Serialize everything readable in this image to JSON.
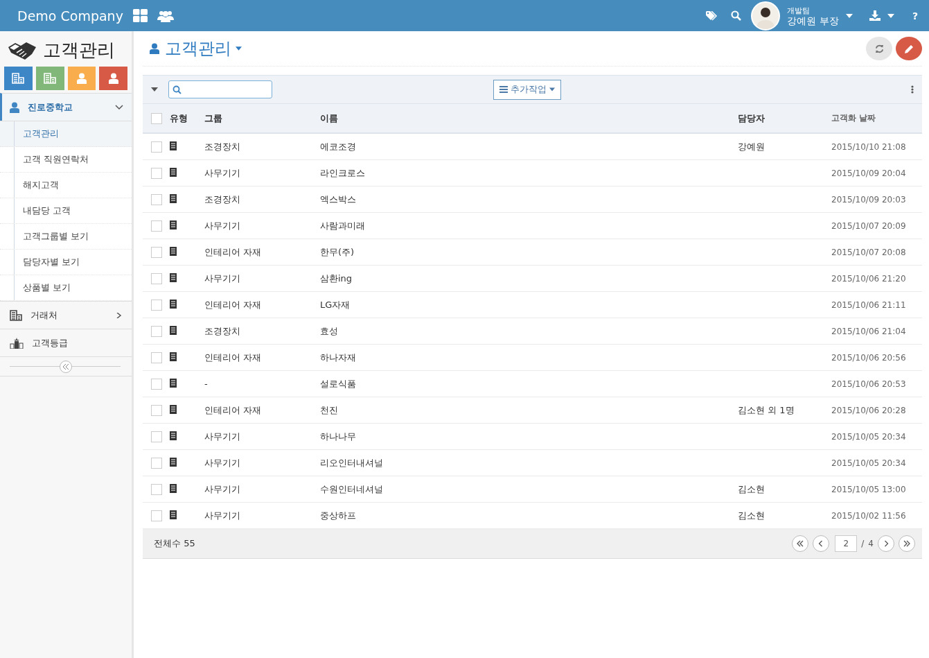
{
  "header": {
    "brand": "Demo Company",
    "user": {
      "team": "개발팀",
      "name": "강예원 부장"
    },
    "help": "?"
  },
  "sidebar": {
    "title": "고객관리",
    "tiles": [
      {
        "kind": "building",
        "color": "#3d87c6"
      },
      {
        "kind": "building",
        "color": "#82b77a"
      },
      {
        "kind": "person",
        "color": "#f9ad4c"
      },
      {
        "kind": "person",
        "color": "#d65a46"
      }
    ],
    "menu": [
      {
        "label": "진로중학교",
        "kind": "person",
        "expanded": true,
        "children": [
          {
            "label": "고객관리",
            "selected": true
          },
          {
            "label": "고객 직원연락처",
            "selected": false
          },
          {
            "label": "해지고객",
            "selected": false
          },
          {
            "label": "내담당 고객",
            "selected": false
          },
          {
            "label": "고객그룹별 보기",
            "selected": false
          },
          {
            "label": "담당자별 보기",
            "selected": false
          },
          {
            "label": "상품별 보기",
            "selected": false
          }
        ]
      },
      {
        "label": "거래처",
        "kind": "building",
        "expanded": false
      },
      {
        "label": "고객등급",
        "kind": "grade"
      }
    ]
  },
  "page": {
    "title": "고객관리"
  },
  "toolbar": {
    "actions_button": "추가작업"
  },
  "table": {
    "all_checked": false,
    "columns": [
      "유형",
      "그룹",
      "이름",
      "담당자",
      "고객화 날짜"
    ],
    "rows": [
      {
        "checked": false,
        "group": "조경장치",
        "name": "에코조경",
        "manager": "강예원",
        "date": "2015/10/10 21:08"
      },
      {
        "checked": false,
        "group": "사무기기",
        "name": "라인크로스",
        "manager": "",
        "date": "2015/10/09 20:04"
      },
      {
        "checked": false,
        "group": "조경장치",
        "name": "엑스박스",
        "manager": "",
        "date": "2015/10/09 20:03"
      },
      {
        "checked": false,
        "group": "사무기기",
        "name": "사람과미래",
        "manager": "",
        "date": "2015/10/07 20:09"
      },
      {
        "checked": false,
        "group": "인테리어 자재",
        "name": "한무(주)",
        "manager": "",
        "date": "2015/10/07 20:08"
      },
      {
        "checked": false,
        "group": "사무기기",
        "name": "삼환ing",
        "manager": "",
        "date": "2015/10/06 21:20"
      },
      {
        "checked": false,
        "group": "인테리어 자재",
        "name": "LG자재",
        "manager": "",
        "date": "2015/10/06 21:11"
      },
      {
        "checked": false,
        "group": "조경장치",
        "name": "효성",
        "manager": "",
        "date": "2015/10/06 21:04"
      },
      {
        "checked": false,
        "group": "인테리어 자재",
        "name": "하나자재",
        "manager": "",
        "date": "2015/10/06 20:56"
      },
      {
        "checked": false,
        "group": "-",
        "name": "설로식품",
        "manager": "",
        "date": "2015/10/06 20:53"
      },
      {
        "checked": false,
        "group": "인테리어 자재",
        "name": "천진",
        "manager": "김소현 외 1명",
        "date": "2015/10/06 20:28"
      },
      {
        "checked": false,
        "group": "사무기기",
        "name": "하나나무",
        "manager": "",
        "date": "2015/10/05 20:34"
      },
      {
        "checked": false,
        "group": "사무기기",
        "name": "리오인터내셔널",
        "manager": "",
        "date": "2015/10/05 20:34"
      },
      {
        "checked": false,
        "group": "사무기기",
        "name": "수원인터네셔널",
        "manager": "김소현",
        "date": "2015/10/05 13:00"
      },
      {
        "checked": false,
        "group": "사무기기",
        "name": "중상하프",
        "manager": "김소현",
        "date": "2015/10/02 11:56"
      }
    ]
  },
  "footer": {
    "total": "전체수 55",
    "page": "2",
    "separator": "/",
    "page_count": "4"
  }
}
